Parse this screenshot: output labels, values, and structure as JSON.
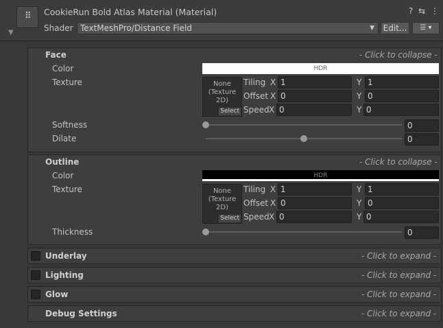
{
  "header": {
    "title": "CookieRun Bold Atlas Material (Material)",
    "shader_label": "Shader",
    "shader_value": "TextMeshPro/Distance Field",
    "edit_label": "Edit...",
    "list_label": "☰ ▾",
    "icons": {
      "help": "?",
      "preset": "⇆",
      "menu": "⋮"
    },
    "material_icon_glyph": "⠿"
  },
  "face": {
    "title": "Face",
    "hint": "- Click to collapse -",
    "color_label": "Color",
    "color_hdr": "HDR",
    "texture_label": "Texture",
    "texture_none": "None (Texture 2D)",
    "texture_select": "Select",
    "tiling_label": "Tiling",
    "offset_label": "Offset",
    "speed_label": "Speed",
    "x_label": "X",
    "y_label": "Y",
    "tiling_x": "1",
    "tiling_y": "1",
    "offset_x": "0",
    "offset_y": "0",
    "speed_x": "0",
    "speed_y": "0",
    "softness_label": "Softness",
    "softness_value": "0",
    "softness_slider_fraction": 0,
    "dilate_label": "Dilate",
    "dilate_value": "0",
    "dilate_slider_fraction": 0.5,
    "color_hex": "#ffffff"
  },
  "outline": {
    "title": "Outline",
    "hint": "- Click to collapse -",
    "color_label": "Color",
    "color_hdr": "HDR",
    "texture_label": "Texture",
    "texture_none": "None (Texture 2D)",
    "texture_select": "Select",
    "tiling_label": "Tiling",
    "offset_label": "Offset",
    "speed_label": "Speed",
    "x_label": "X",
    "y_label": "Y",
    "tiling_x": "1",
    "tiling_y": "1",
    "offset_x": "0",
    "offset_y": "0",
    "speed_x": "0",
    "speed_y": "0",
    "thickness_label": "Thickness",
    "thickness_value": "0",
    "thickness_slider_fraction": 0,
    "color_hex": "#000000"
  },
  "collapsed": [
    {
      "title": "Underlay",
      "hint": "- Click to expand -",
      "has_checkbox": true
    },
    {
      "title": "Lighting",
      "hint": "- Click to expand -",
      "has_checkbox": true
    },
    {
      "title": "Glow",
      "hint": "- Click to expand -",
      "has_checkbox": true
    },
    {
      "title": "Debug Settings",
      "hint": "- Click to expand -",
      "has_checkbox": false
    }
  ],
  "colors": {
    "background": "#383838",
    "panel": "#3e3e3e",
    "field": "#2a2a2a"
  }
}
